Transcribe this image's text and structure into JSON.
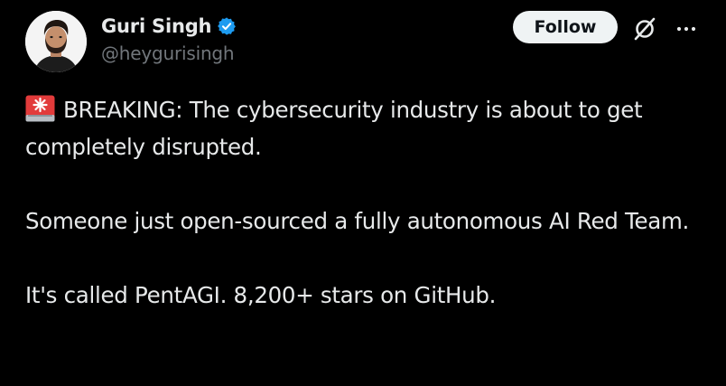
{
  "author": {
    "display_name": "Guri Singh",
    "handle": "@heygurisingh",
    "verified": true,
    "verified_color": "#1d9bf0"
  },
  "actions": {
    "follow_label": "Follow",
    "grok_icon": "grok-icon",
    "more_icon": "more-options-icon"
  },
  "tweet": {
    "emoji_icon": "police-siren-icon",
    "line1": "BREAKING: The cybersecurity industry is about to get completely disrupted.",
    "paragraph2": "Someone just open-sourced a fully autonomous AI Red Team.",
    "paragraph3": "It's called PentAGI. 8,200+ stars on GitHub."
  },
  "colors": {
    "background": "#000000",
    "text_primary": "#e7e9ea",
    "text_secondary": "#71767b",
    "follow_bg": "#eff3f4",
    "follow_text": "#0f1419"
  }
}
